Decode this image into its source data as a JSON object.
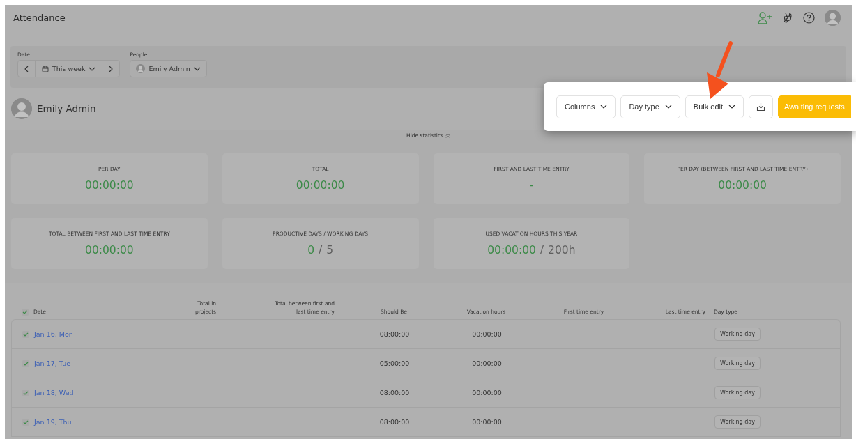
{
  "header": {
    "title": "Attendance"
  },
  "filters": {
    "date": {
      "label": "Date",
      "range": "This week"
    },
    "people": {
      "label": "People",
      "value": "Emily Admin"
    }
  },
  "user": {
    "name": "Emily Admin"
  },
  "toolbar": {
    "buttons": [
      {
        "kind": "dropdown",
        "label": "Columns"
      },
      {
        "kind": "dropdown",
        "label": "Day type"
      },
      {
        "kind": "dropdown",
        "label": "Bulk edit"
      },
      {
        "kind": "download"
      },
      {
        "kind": "primary",
        "label": "Awaiting requests"
      }
    ]
  },
  "statistics_toggle": "Hide statistics",
  "stats": [
    {
      "title": "PER DAY",
      "value": "00:00:00"
    },
    {
      "title": "TOTAL",
      "value": "00:00:00"
    },
    {
      "title": "FIRST AND LAST TIME ENTRY",
      "value": "-"
    },
    {
      "title": "PER DAY (BETWEEN FIRST AND LAST TIME ENTRY)",
      "value": "00:00:00"
    },
    {
      "title": "TOTAL BETWEEN FIRST AND LAST TIME ENTRY",
      "value": "00:00:00"
    },
    {
      "title": "PRODUCTIVE DAYS / WORKING DAYS",
      "value": "0",
      "separator": "/",
      "total": "5"
    },
    {
      "title": "USED VACATION HOURS THIS YEAR",
      "value": "00:00:00",
      "separator": "/",
      "total": "200h"
    }
  ],
  "table": {
    "all_checked": true,
    "columns": [
      "Date",
      "Total in projects",
      "Total between first and last time entry",
      "Should Be",
      "Vacation hours",
      "First time entry",
      "Last time entry",
      "Day type"
    ],
    "rows": [
      {
        "checked": true,
        "date": "Jan 16, Mon",
        "should_be": "08:00:00",
        "vacation_hours": "00:00:00",
        "day_type": "Working day"
      },
      {
        "checked": true,
        "date": "Jan 17, Tue",
        "should_be": "05:00:00",
        "vacation_hours": "00:00:00",
        "day_type": "Working day"
      },
      {
        "checked": true,
        "date": "Jan 18, Wed",
        "should_be": "08:00:00",
        "vacation_hours": "00:00:00",
        "day_type": "Working day"
      },
      {
        "checked": true,
        "date": "Jan 19, Thu",
        "should_be": "08:00:00",
        "vacation_hours": "00:00:00",
        "day_type": "Working day"
      }
    ]
  }
}
